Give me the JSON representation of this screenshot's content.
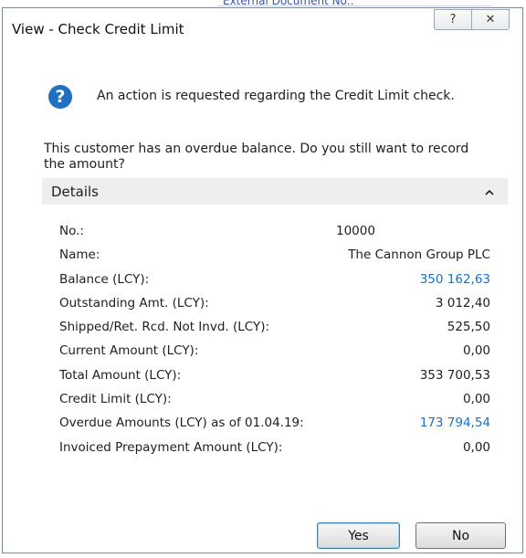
{
  "background": {
    "behind_text": "External Document No.:"
  },
  "dialog": {
    "title": "View - Check Credit Limit",
    "help_button": "?",
    "close_button": "✕"
  },
  "message": "An action is requested regarding the Credit Limit check.",
  "question": "This customer has an overdue balance. Do you still want to record the amount?",
  "details": {
    "header": "Details",
    "rows": [
      {
        "label": "No.:",
        "value": "10000"
      },
      {
        "label": "Name:",
        "value": "The Cannon Group PLC"
      },
      {
        "label": "Balance (LCY):",
        "value": "350 162,63"
      },
      {
        "label": "Outstanding Amt. (LCY):",
        "value": "3 012,40"
      },
      {
        "label": "Shipped/Ret. Rcd. Not Invd. (LCY):",
        "value": "525,50"
      },
      {
        "label": "Current Amount (LCY):",
        "value": "0,00"
      },
      {
        "label": "Total Amount (LCY):",
        "value": "353 700,53"
      },
      {
        "label": "Credit Limit (LCY):",
        "value": "0,00"
      },
      {
        "label": "Overdue Amounts (LCY) as of 01.04.19:",
        "value": "173 794,54"
      },
      {
        "label": "Invoiced Prepayment Amount (LCY):",
        "value": "0,00"
      }
    ]
  },
  "buttons": {
    "yes": "Yes",
    "no": "No"
  },
  "colors": {
    "link": "#1f6fc5",
    "info_icon": "#1f70c0",
    "details_bg": "#eeeeee"
  }
}
